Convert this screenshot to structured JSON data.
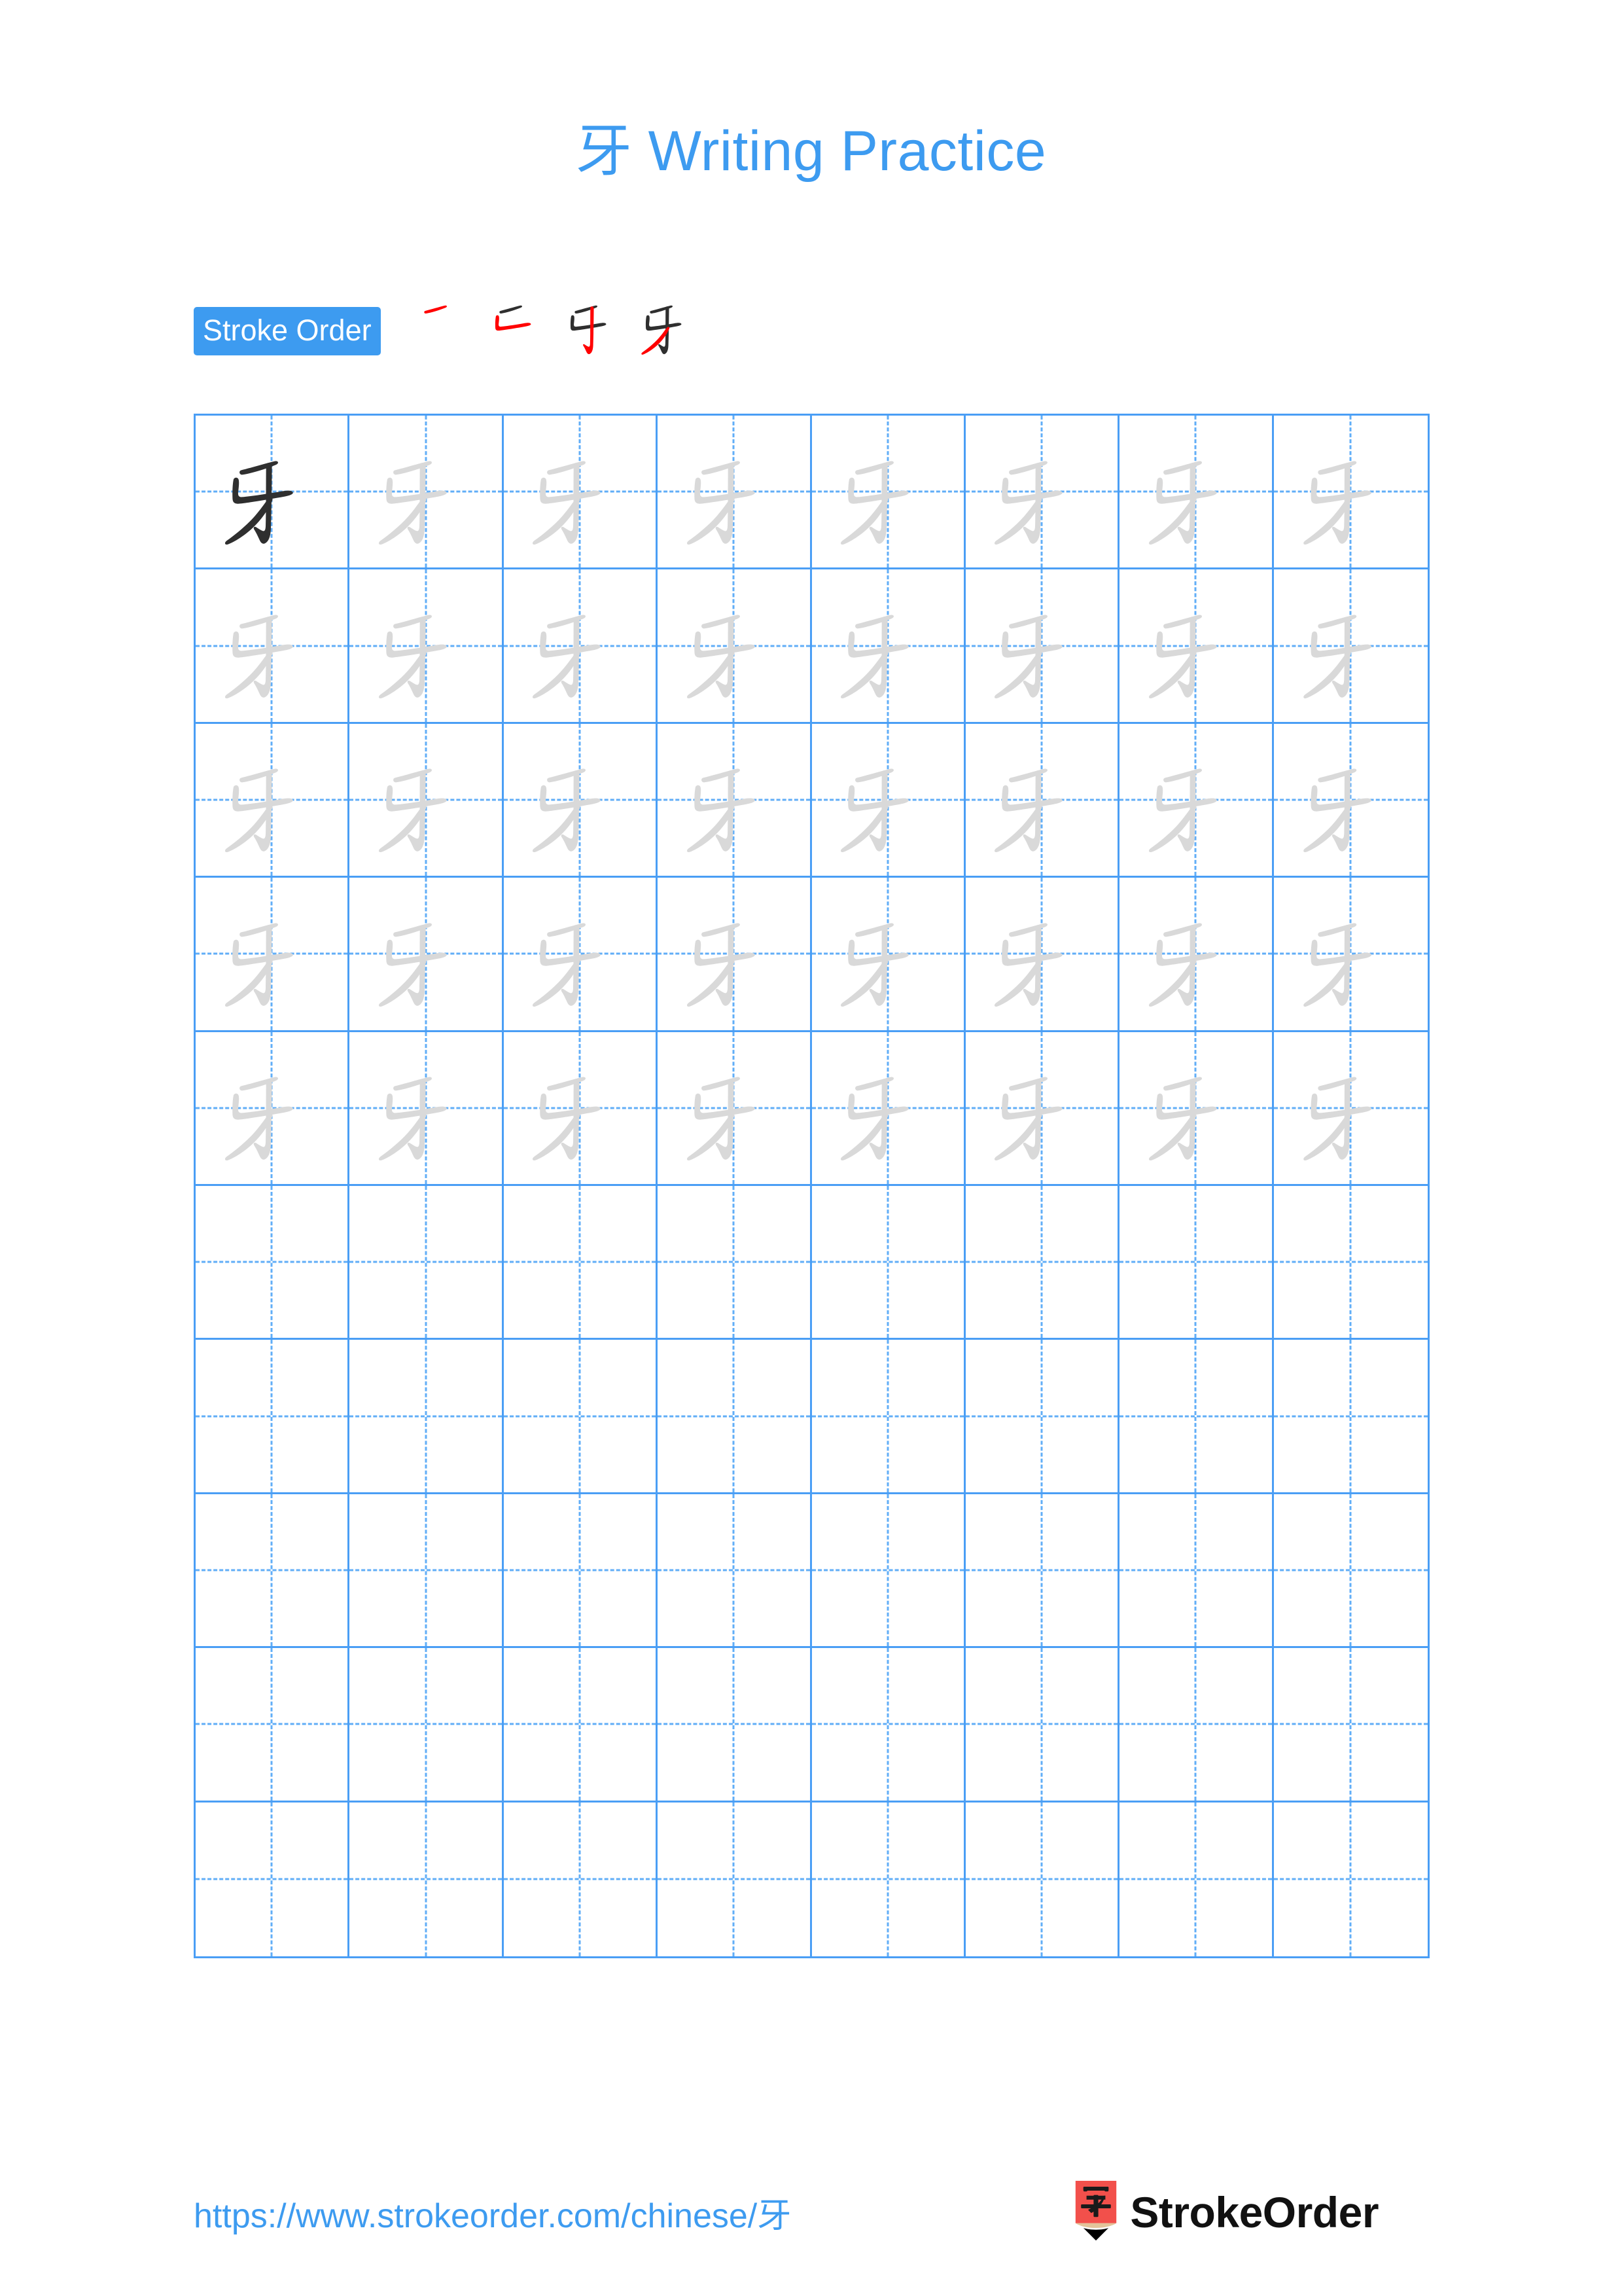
{
  "document": {
    "character": "牙",
    "title": "牙 Writing Practice",
    "accent_color": "#3d9bf0",
    "grid_line_color": "#4a9ef5",
    "guide_line_color": "#61aef7",
    "trace_color": "#d9d9d9",
    "ink_color": "#2f2f2f",
    "new_stroke_color": "#ff0000"
  },
  "stroke_order": {
    "label": "Stroke Order",
    "stroke_count": 4,
    "steps": [
      {
        "index": 1,
        "new_stroke": "heng",
        "strokes_shown": 1
      },
      {
        "index": 2,
        "new_stroke": "shu-zhe",
        "strokes_shown": 2
      },
      {
        "index": 3,
        "new_stroke": "shu-gou",
        "strokes_shown": 3
      },
      {
        "index": 4,
        "new_stroke": "pie",
        "strokes_shown": 4
      }
    ]
  },
  "practice_grid": {
    "columns": 8,
    "rows": 10,
    "cells": [
      [
        "ink",
        "trace",
        "trace",
        "trace",
        "trace",
        "trace",
        "trace",
        "trace"
      ],
      [
        "trace",
        "trace",
        "trace",
        "trace",
        "trace",
        "trace",
        "trace",
        "trace"
      ],
      [
        "trace",
        "trace",
        "trace",
        "trace",
        "trace",
        "trace",
        "trace",
        "trace"
      ],
      [
        "trace",
        "trace",
        "trace",
        "trace",
        "trace",
        "trace",
        "trace",
        "trace"
      ],
      [
        "trace",
        "trace",
        "trace",
        "trace",
        "trace",
        "trace",
        "trace",
        "trace"
      ],
      [
        "empty",
        "empty",
        "empty",
        "empty",
        "empty",
        "empty",
        "empty",
        "empty"
      ],
      [
        "empty",
        "empty",
        "empty",
        "empty",
        "empty",
        "empty",
        "empty",
        "empty"
      ],
      [
        "empty",
        "empty",
        "empty",
        "empty",
        "empty",
        "empty",
        "empty",
        "empty"
      ],
      [
        "empty",
        "empty",
        "empty",
        "empty",
        "empty",
        "empty",
        "empty",
        "empty"
      ],
      [
        "empty",
        "empty",
        "empty",
        "empty",
        "empty",
        "empty",
        "empty",
        "empty"
      ]
    ]
  },
  "footer": {
    "url": "https://www.strokeorder.com/chinese/牙",
    "brand_name": "StrokeOrder",
    "logo_character": "字",
    "logo_body_color": "#f2504b",
    "logo_wood_color": "#e3c49a",
    "logo_tip_color": "#000000"
  }
}
